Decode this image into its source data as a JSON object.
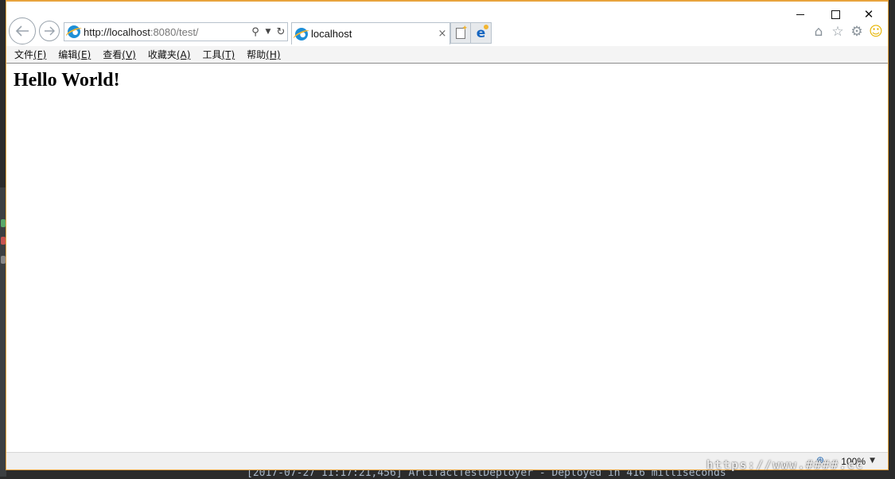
{
  "window": {
    "minimize_icon": "minimize-icon",
    "maximize_icon": "maximize-icon",
    "close_icon": "close-icon"
  },
  "addressbar": {
    "url_host": "http://localhost",
    "url_port_path": ":8080/test/",
    "search_icon": "search-icon",
    "dropdown_icon": "chevron-down-icon",
    "refresh_icon": "refresh-icon"
  },
  "tab": {
    "title": "localhost",
    "close_symbol": "×"
  },
  "menu": {
    "items": [
      {
        "label": "文件",
        "key": "(F)"
      },
      {
        "label": "编辑",
        "key": "(E)"
      },
      {
        "label": "查看",
        "key": "(V)"
      },
      {
        "label": "收藏夹",
        "key": "(A)"
      },
      {
        "label": "工具",
        "key": "(T)"
      },
      {
        "label": "帮助",
        "key": "(H)"
      }
    ]
  },
  "content": {
    "heading": "Hello World!"
  },
  "statusbar": {
    "zoom": "100%"
  },
  "background": {
    "console_line": "[2017-07-27 11:17:21,456] ArtifactTestDeployer - Deployed in 416 milliseconds",
    "watermark": "https://www.####.cc"
  },
  "colors": {
    "window_border": "#e8a33d",
    "ide_background": "#2b2b2b"
  }
}
